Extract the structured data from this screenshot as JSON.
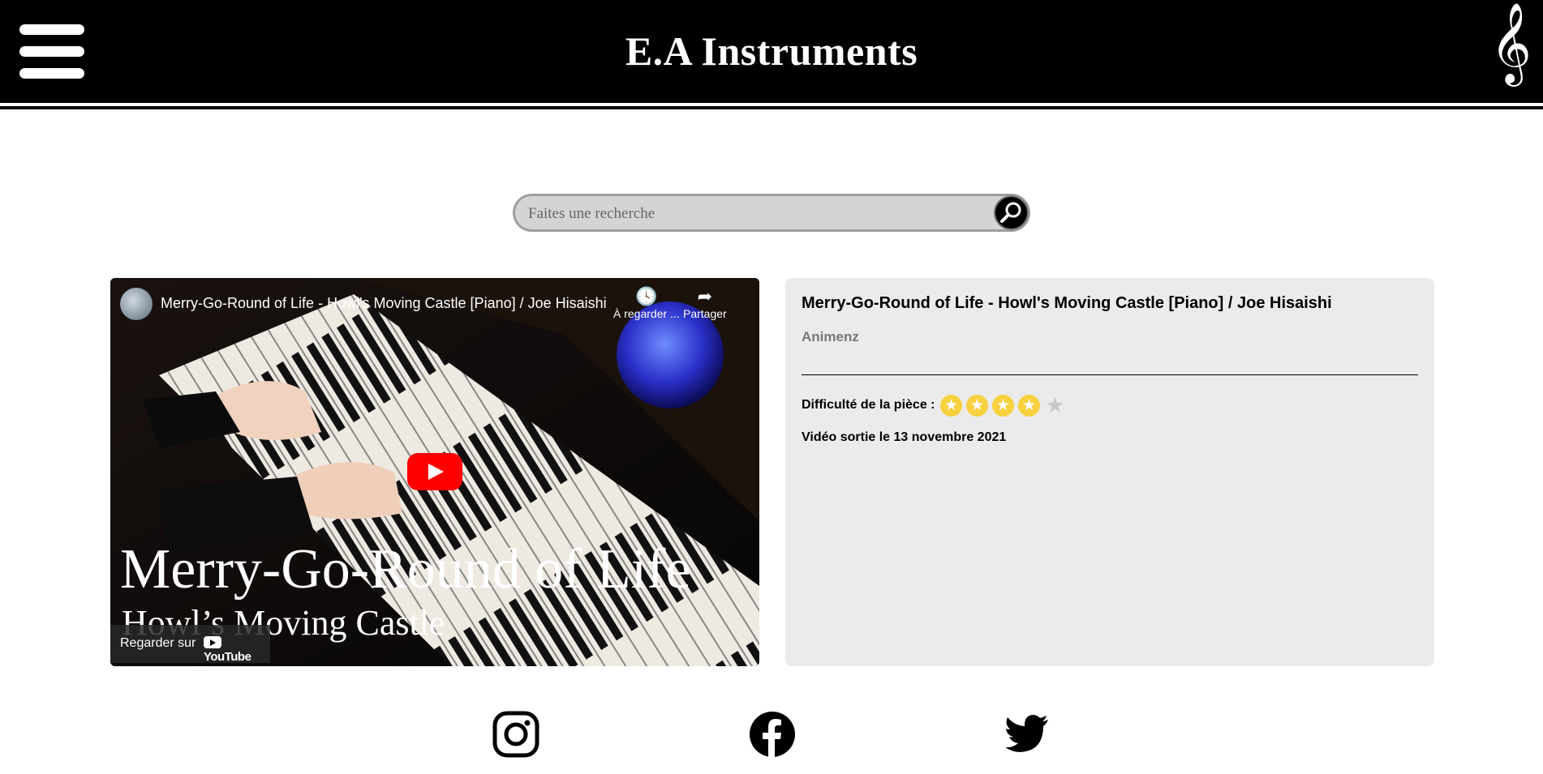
{
  "header": {
    "brand": "E.A Instruments",
    "clef_glyph": "𝄞"
  },
  "search": {
    "placeholder": "Faites une recherche"
  },
  "video": {
    "title": "Merry-Go-Round of Life - Howl's Moving Castle [Piano] / Joe Hisaishi",
    "watch_later": "À regarder ...",
    "share": "Partager",
    "thumb_title": "Merry-Go-Round of Life",
    "thumb_subtitle": "Howl’s Moving Castle",
    "watch_on": "Regarder sur",
    "youtube": "YouTube"
  },
  "details": {
    "title": "Merry-Go-Round of Life - Howl's Moving Castle [Piano] / Joe Hisaishi",
    "channel": "Animenz",
    "difficulty_label": "Difficulté de la pièce :",
    "difficulty_stars": 4,
    "difficulty_max": 5,
    "release": "Vidéo sortie le 13 novembre 2021"
  },
  "social": [
    "instagram-icon",
    "facebook-icon",
    "twitter-icon"
  ],
  "colors": {
    "header": "#000000",
    "panel": "#ebebeb",
    "star": "#f7d13e",
    "play": "#ff0000"
  }
}
